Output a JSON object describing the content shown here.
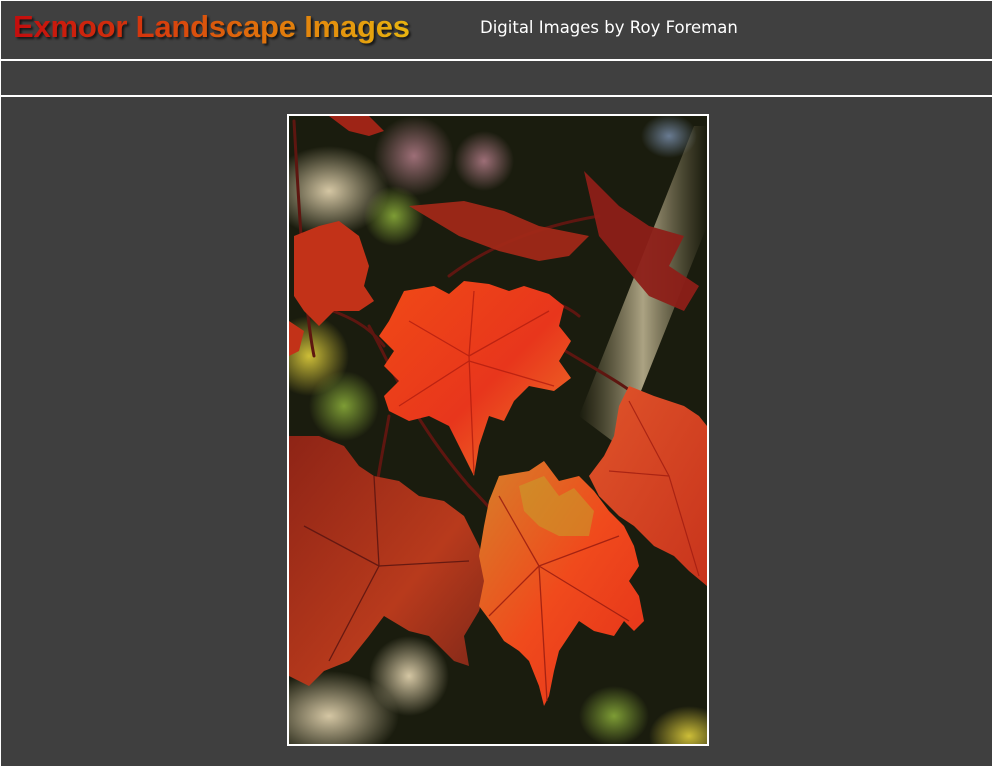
{
  "header": {
    "site_title": "Exmoor Landscape Images",
    "tagline": "Digital Images by Roy Foreman"
  },
  "navbar": {
    "items": []
  },
  "main": {
    "photo": {
      "subject_icon": "maple-leaves-photo"
    }
  },
  "colors": {
    "page_background": "#3f3f3f",
    "rule": "#ffffff",
    "title_gradient_start": "#c40d0d",
    "title_gradient_end": "#e8b40f"
  }
}
